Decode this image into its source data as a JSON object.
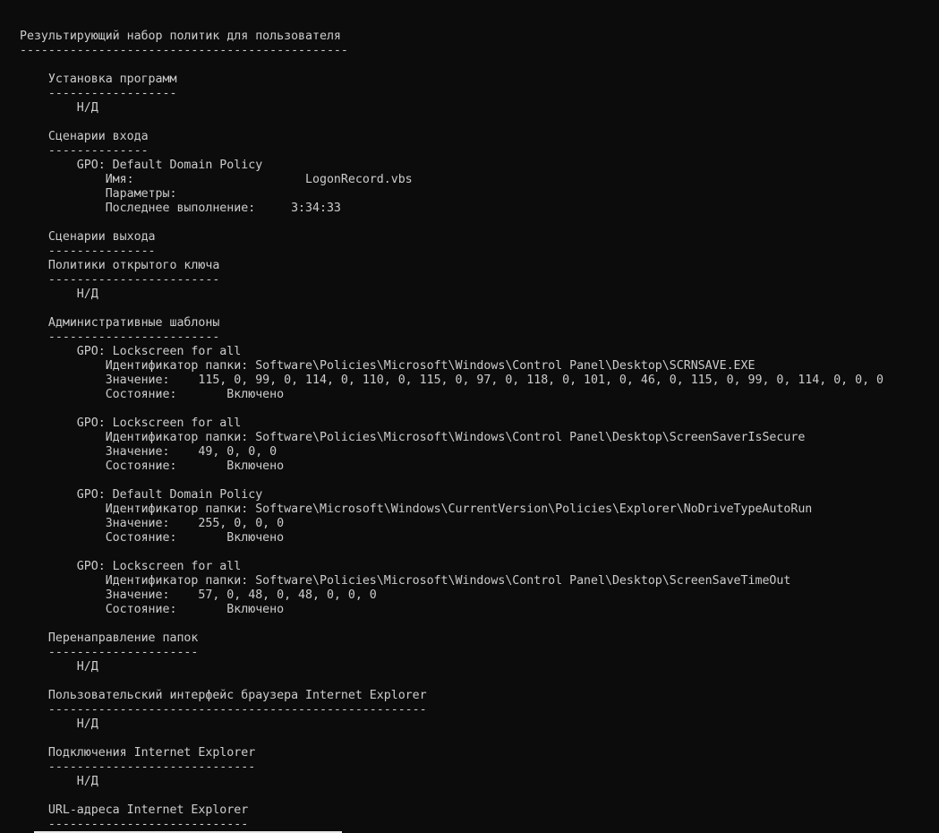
{
  "console": {
    "lines": [
      "Результирующий набор политик для пользователя",
      "----------------------------------------------",
      "",
      "    Установка программ",
      "    ------------------",
      "        Н/Д",
      "",
      "    Сценарии входа",
      "    --------------",
      "        GPO: Default Domain Policy",
      "            Имя:                        LogonRecord.vbs",
      "            Параметры:",
      "            Последнее выполнение:     3:34:33",
      "",
      "    Сценарии выхода",
      "    ---------------",
      "    Политики открытого ключа",
      "    ------------------------",
      "        Н/Д",
      "",
      "    Административные шаблоны",
      "    ------------------------",
      "        GPO: Lockscreen for all",
      "            Идентификатор папки: Software\\Policies\\Microsoft\\Windows\\Control Panel\\Desktop\\SCRNSAVE.EXE",
      "            Значение:    115, 0, 99, 0, 114, 0, 110, 0, 115, 0, 97, 0, 118, 0, 101, 0, 46, 0, 115, 0, 99, 0, 114, 0, 0, 0",
      "            Состояние:       Включено",
      "",
      "        GPO: Lockscreen for all",
      "            Идентификатор папки: Software\\Policies\\Microsoft\\Windows\\Control Panel\\Desktop\\ScreenSaverIsSecure",
      "            Значение:    49, 0, 0, 0",
      "            Состояние:       Включено",
      "",
      "        GPO: Default Domain Policy",
      "            Идентификатор папки: Software\\Microsoft\\Windows\\CurrentVersion\\Policies\\Explorer\\NoDriveTypeAutoRun",
      "            Значение:    255, 0, 0, 0",
      "            Состояние:       Включено",
      "",
      "        GPO: Lockscreen for all",
      "            Идентификатор папки: Software\\Policies\\Microsoft\\Windows\\Control Panel\\Desktop\\ScreenSaveTimeOut",
      "            Значение:    57, 0, 48, 0, 48, 0, 0, 0",
      "            Состояние:       Включено",
      "",
      "    Перенаправление папок",
      "    ---------------------",
      "        Н/Д",
      "",
      "    Пользовательский интерфейс браузера Internet Explorer",
      "    -----------------------------------------------------",
      "        Н/Д",
      "",
      "    Подключения Internet Explorer",
      "    -----------------------------",
      "        Н/Д",
      "",
      "    URL-адреса Internet Explorer",
      "    ----------------------------"
    ]
  },
  "colors": {
    "background": "#0c0c0c",
    "text": "#cccccc"
  }
}
